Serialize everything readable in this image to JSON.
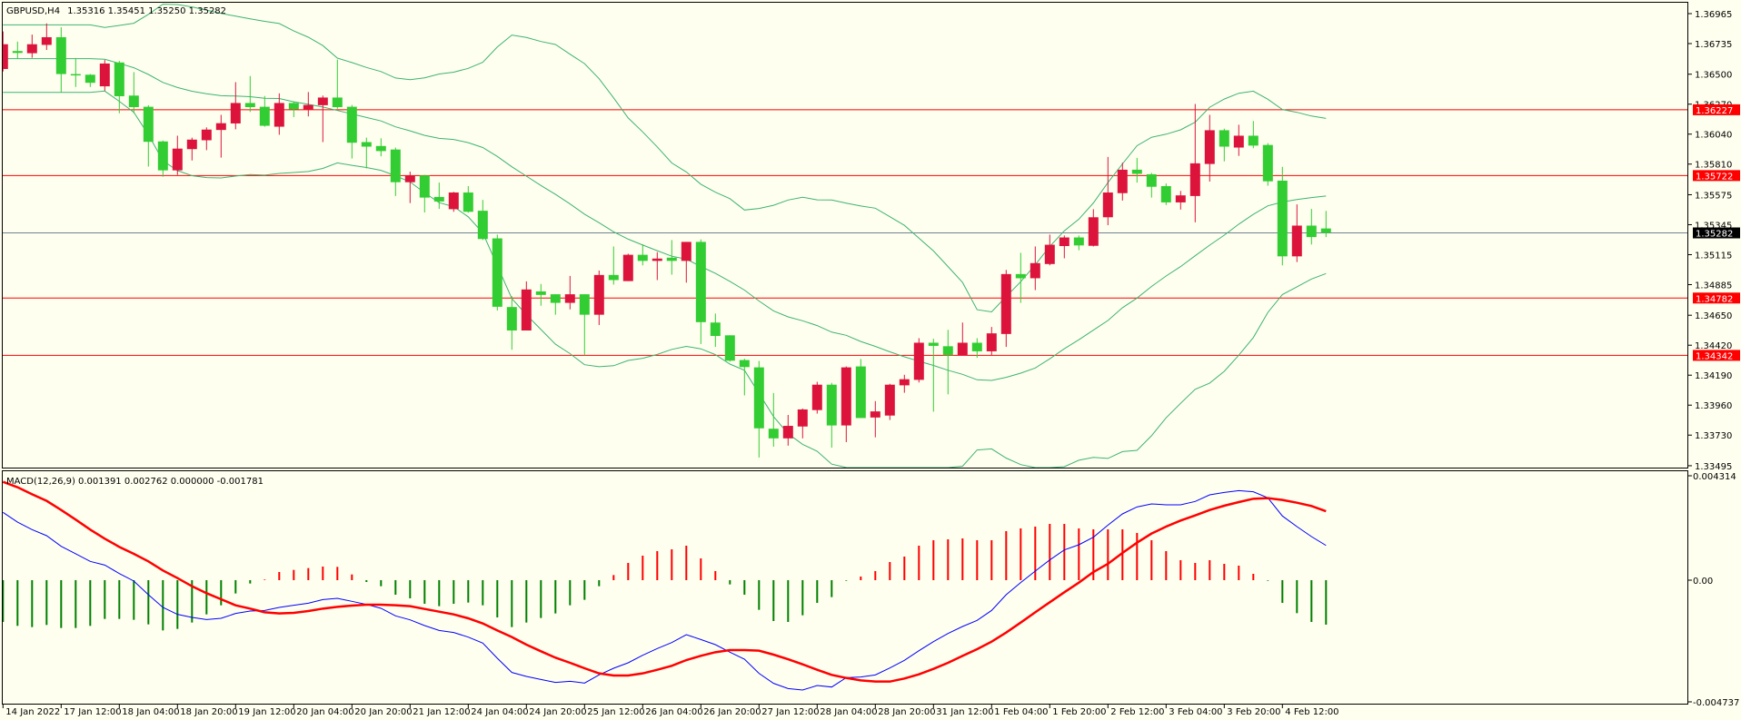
{
  "header": {
    "symbol": "GBPUSD,H4",
    "ohlc_text": "1.35316 1.35451 1.35250 1.35282"
  },
  "macd_header": {
    "label": "MACD(12,26,9)",
    "values_text": "0.001391 0.002762 0.000000 -0.001781"
  },
  "colors": {
    "background": "#fffff0",
    "bull": "#dc143c",
    "bear": "#32cd32",
    "bands": "#3cb371",
    "level_line": "#ff0000",
    "price_line": "#708090",
    "macd_main": "#0000ff",
    "macd_signal": "#ff0000",
    "hist_pos": "#ff0000",
    "hist_neg": "#008000"
  },
  "chart_data": [
    {
      "type": "candlestick",
      "title": "GBPUSD,H4",
      "indicator": "Bollinger Bands (20, 2)",
      "ylim": [
        1.33495,
        1.36965
      ],
      "y_ticks": [
        "1.36965",
        "1.36735",
        "1.36500",
        "1.36270",
        "1.36040",
        "1.35810",
        "1.35575",
        "1.35345",
        "1.35115",
        "1.34885",
        "1.34650",
        "1.34420",
        "1.34190",
        "1.33960",
        "1.33730",
        "1.33495"
      ],
      "x_ticks": [
        "14 Jan 2022",
        "17 Jan 12:00",
        "18 Jan 04:00",
        "18 Jan 20:00",
        "19 Jan 12:00",
        "20 Jan 04:00",
        "20 Jan 20:00",
        "21 Jan 12:00",
        "24 Jan 04:00",
        "24 Jan 20:00",
        "25 Jan 12:00",
        "26 Jan 04:00",
        "26 Jan 20:00",
        "27 Jan 12:00",
        "28 Jan 04:00",
        "28 Jan 20:00",
        "31 Jan 12:00",
        "1 Feb 04:00",
        "1 Feb 20:00",
        "2 Feb 12:00",
        "3 Feb 04:00",
        "3 Feb 20:00",
        "4 Feb 12:00"
      ],
      "x_tick_every_n_bars": 4,
      "levels": [
        {
          "price": 1.36227,
          "label": "1.36227"
        },
        {
          "price": 1.35722,
          "label": "1.35722"
        },
        {
          "price": 1.34782,
          "label": "1.34782"
        },
        {
          "price": 1.34342,
          "label": "1.34342"
        }
      ],
      "current_price": {
        "price": 1.35282,
        "label": "1.35282"
      },
      "ohlc": [
        [
          1.3654,
          1.36828,
          1.36521,
          1.3673
        ],
        [
          1.36678,
          1.3675,
          1.36619,
          1.36663
        ],
        [
          1.36661,
          1.36804,
          1.36626,
          1.3673
        ],
        [
          1.36725,
          1.3689,
          1.36686,
          1.36784
        ],
        [
          1.36784,
          1.3686,
          1.3636,
          1.36501
        ],
        [
          1.36501,
          1.36624,
          1.36402,
          1.36493
        ],
        [
          1.36496,
          1.36501,
          1.36402,
          1.36434
        ],
        [
          1.36407,
          1.36609,
          1.36373,
          1.36582
        ],
        [
          1.3659,
          1.36602,
          1.362,
          1.36331
        ],
        [
          1.36336,
          1.36516,
          1.362,
          1.36247
        ],
        [
          1.3625,
          1.36262,
          1.35791,
          1.35981
        ],
        [
          1.35984,
          1.35991,
          1.35713,
          1.35762
        ],
        [
          1.35762,
          1.36028,
          1.35727,
          1.35929
        ],
        [
          1.35925,
          1.36013,
          1.35838,
          1.35998
        ],
        [
          1.35993,
          1.36092,
          1.35917,
          1.36075
        ],
        [
          1.36072,
          1.36188,
          1.3586,
          1.36124
        ],
        [
          1.36122,
          1.36439,
          1.36077,
          1.36279
        ],
        [
          1.36279,
          1.36486,
          1.3621,
          1.36247
        ],
        [
          1.3625,
          1.36333,
          1.36097,
          1.36104
        ],
        [
          1.36097,
          1.36353,
          1.36035,
          1.36279
        ],
        [
          1.36279,
          1.36292,
          1.36171,
          1.3623
        ],
        [
          1.3623,
          1.36363,
          1.36176,
          1.36264
        ],
        [
          1.36262,
          1.36336,
          1.35979,
          1.36321
        ],
        [
          1.36321,
          1.36612,
          1.36235,
          1.36247
        ],
        [
          1.3625,
          1.36264,
          1.35853,
          1.35974
        ],
        [
          1.35979,
          1.36013,
          1.35777,
          1.35944
        ],
        [
          1.35949,
          1.36008,
          1.3587,
          1.3591
        ],
        [
          1.35922,
          1.35937,
          1.35565,
          1.35671
        ],
        [
          1.35671,
          1.35752,
          1.35511,
          1.35723
        ],
        [
          1.35723,
          1.35727,
          1.35439,
          1.35553
        ],
        [
          1.35558,
          1.35668,
          1.35466,
          1.35523
        ],
        [
          1.35464,
          1.35597,
          1.35444,
          1.35592
        ],
        [
          1.35592,
          1.35641,
          1.35437,
          1.35444
        ],
        [
          1.35452,
          1.35535,
          1.35227,
          1.35235
        ],
        [
          1.3524,
          1.35269,
          1.34686,
          1.34715
        ],
        [
          1.34713,
          1.34796,
          1.34385,
          1.34533
        ],
        [
          1.34533,
          1.3491,
          1.34533,
          1.34848
        ],
        [
          1.34833,
          1.3489,
          1.34723,
          1.34806
        ],
        [
          1.34811,
          1.34811,
          1.34654,
          1.34745
        ],
        [
          1.34745,
          1.34952,
          1.34695,
          1.34811
        ],
        [
          1.34811,
          1.34811,
          1.34343,
          1.34654
        ],
        [
          1.34654,
          1.34993,
          1.34575,
          1.34959
        ],
        [
          1.34959,
          1.35178,
          1.34885,
          1.3492
        ],
        [
          1.34912,
          1.35122,
          1.34912,
          1.35114
        ],
        [
          1.35114,
          1.35195,
          1.35033,
          1.35067
        ],
        [
          1.35067,
          1.35134,
          1.3492,
          1.35085
        ],
        [
          1.35092,
          1.35227,
          1.34961,
          1.35067
        ],
        [
          1.35067,
          1.35213,
          1.349,
          1.35213
        ],
        [
          1.35213,
          1.35232,
          1.34429,
          1.34597
        ],
        [
          1.34594,
          1.34663,
          1.34407,
          1.34491
        ],
        [
          1.34496,
          1.34496,
          1.34294,
          1.34301
        ],
        [
          1.34306,
          1.34316,
          1.34035,
          1.34252
        ],
        [
          1.3425,
          1.34299,
          1.33558,
          1.33782
        ],
        [
          1.33779,
          1.34053,
          1.33641,
          1.33705
        ],
        [
          1.33705,
          1.33885,
          1.33649,
          1.33801
        ],
        [
          1.33796,
          1.33934,
          1.33705,
          1.33927
        ],
        [
          1.33922,
          1.34139,
          1.33895,
          1.34117
        ],
        [
          1.34117,
          1.34131,
          1.33634,
          1.33804
        ],
        [
          1.33804,
          1.34257,
          1.33676,
          1.3425
        ],
        [
          1.34257,
          1.34314,
          1.33861,
          1.33861
        ],
        [
          1.33865,
          1.33991,
          1.33713,
          1.33912
        ],
        [
          1.3388,
          1.34124,
          1.33846,
          1.34117
        ],
        [
          1.34112,
          1.34193,
          1.34055,
          1.34159
        ],
        [
          1.34154,
          1.34474,
          1.34134,
          1.34439
        ],
        [
          1.34439,
          1.34469,
          1.3391,
          1.34415
        ],
        [
          1.34412,
          1.34538,
          1.34043,
          1.34343
        ],
        [
          1.34341,
          1.34594,
          1.34341,
          1.34439
        ],
        [
          1.34439,
          1.34474,
          1.34324,
          1.34373
        ],
        [
          1.34373,
          1.3456,
          1.34341,
          1.34511
        ],
        [
          1.34506,
          1.34998,
          1.34407,
          1.34966
        ],
        [
          1.34966,
          1.35129,
          1.34745,
          1.34934
        ],
        [
          1.34934,
          1.35178,
          1.34843,
          1.3505
        ],
        [
          1.35043,
          1.35269,
          1.35033,
          1.35191
        ],
        [
          1.35181,
          1.35262,
          1.35087,
          1.35247
        ],
        [
          1.35247,
          1.35262,
          1.35149,
          1.35186
        ],
        [
          1.35183,
          1.35464,
          1.35178,
          1.35402
        ],
        [
          1.35402,
          1.35865,
          1.35341,
          1.35592
        ],
        [
          1.35587,
          1.35821,
          1.3553,
          1.35767
        ],
        [
          1.35767,
          1.35858,
          1.35668,
          1.35735
        ],
        [
          1.35732,
          1.35742,
          1.35553,
          1.35636
        ],
        [
          1.35641,
          1.35661,
          1.35496,
          1.35516
        ],
        [
          1.35516,
          1.35604,
          1.35461,
          1.3557
        ],
        [
          1.35565,
          1.36272,
          1.35363,
          1.35816
        ],
        [
          1.35811,
          1.36188,
          1.35676,
          1.3607
        ],
        [
          1.3607,
          1.36082,
          1.35831,
          1.35944
        ],
        [
          1.35937,
          1.36112,
          1.35873,
          1.36028
        ],
        [
          1.36028,
          1.36141,
          1.35932,
          1.35952
        ],
        [
          1.35957,
          1.35971,
          1.35644,
          1.35678
        ],
        [
          1.35683,
          1.35789,
          1.35033,
          1.35102
        ],
        [
          1.35102,
          1.35501,
          1.35058,
          1.35338
        ],
        [
          1.35338,
          1.35466,
          1.35193,
          1.3525
        ],
        [
          1.35316,
          1.35451,
          1.3525,
          1.35282
        ]
      ]
    },
    {
      "type": "line+bar",
      "title": "MACD(12,26,9)",
      "ylim": [
        -0.004737,
        0.004314
      ],
      "y_ticks": [
        "0.004314",
        "0.00",
        "-0.004737"
      ],
      "main": [
        0.002715,
        0.002327,
        0.002024,
        0.001782,
        0.001358,
        0.001055,
        0.000752,
        0.000606,
        0.000267,
        -3.6e-05,
        -0.000582,
        -0.001091,
        -0.00137,
        -0.001491,
        -0.001576,
        -0.001527,
        -0.001333,
        -0.001236,
        -0.001212,
        -0.001091,
        -0.001006,
        -0.000921,
        -0.000776,
        -0.000727,
        -0.000848,
        -0.00097,
        -0.001127,
        -0.00143,
        -0.001588,
        -0.001818,
        -0.002012,
        -0.002097,
        -0.002279,
        -0.002521,
        -0.003127,
        -0.003697,
        -0.003855,
        -0.003976,
        -0.004097,
        -0.004048,
        -0.004121,
        -0.003794,
        -0.003527,
        -0.003309,
        -0.003006,
        -0.002739,
        -0.002497,
        -0.002182,
        -0.002376,
        -0.002582,
        -0.002885,
        -0.003164,
        -0.003733,
        -0.004133,
        -0.004339,
        -0.0044,
        -0.004218,
        -0.004279,
        -0.003903,
        -0.003879,
        -0.003794,
        -0.003515,
        -0.003212,
        -0.002824,
        -0.002461,
        -0.002133,
        -0.001855,
        -0.001612,
        -0.001212,
        -0.000582,
        -9.7e-05,
        0.000364,
        0.000812,
        0.001212,
        0.001418,
        0.001721,
        0.002206,
        0.002655,
        0.002933,
        0.003055,
        0.003018,
        0.003018,
        0.003152,
        0.003418,
        0.003515,
        0.003588,
        0.003539,
        0.003297,
        0.00257,
        0.002145,
        0.001745,
        0.001391
      ],
      "signal": [
        0.003939,
        0.003721,
        0.003442,
        0.003176,
        0.002812,
        0.002424,
        0.002024,
        0.001661,
        0.001333,
        0.001055,
        0.000752,
        0.000388,
        8.5e-05,
        -0.000242,
        -0.000521,
        -0.000764,
        -0.001006,
        -0.001139,
        -0.001285,
        -0.001333,
        -0.001309,
        -0.001236,
        -0.001139,
        -0.001067,
        -0.001018,
        -0.000982,
        -0.000982,
        -0.001006,
        -0.001042,
        -0.001152,
        -0.001261,
        -0.00137,
        -0.001527,
        -0.001733,
        -0.002012,
        -0.002279,
        -0.002582,
        -0.002848,
        -0.003103,
        -0.003309,
        -0.003527,
        -0.003733,
        -0.003818,
        -0.003818,
        -0.003733,
        -0.003588,
        -0.00343,
        -0.0032,
        -0.00303,
        -0.002885,
        -0.0028,
        -0.0028,
        -0.002824,
        -0.002982,
        -0.003164,
        -0.00337,
        -0.003588,
        -0.003794,
        -0.003915,
        -0.004012,
        -0.004061,
        -0.004061,
        -0.003939,
        -0.00377,
        -0.003552,
        -0.003309,
        -0.00303,
        -0.002764,
        -0.002461,
        -0.002097,
        -0.001697,
        -0.001285,
        -0.000885,
        -0.000485,
        -9.7e-05,
        0.000327,
        0.000655,
        0.001091,
        0.001503,
        0.001867,
        0.002145,
        0.002388,
        0.002594,
        0.002812,
        0.002982,
        0.003127,
        0.003261,
        0.003285,
        0.003212,
        0.003103,
        0.00297,
        0.002762
      ],
      "histogram": [
        -0.001673,
        -0.00183,
        -0.001879,
        -0.001794,
        -0.001915,
        -0.001915,
        -0.00183,
        -0.001552,
        -0.001552,
        -0.001588,
        -0.00177,
        -0.002012,
        -0.001952,
        -0.001697,
        -0.00137,
        -0.001006,
        -0.000533,
        -0.000133,
        2.4e-05,
        0.000327,
        0.000412,
        0.000485,
        0.000545,
        0.000533,
        0.00023,
        -7.3e-05,
        -0.000242,
        -0.000582,
        -0.000727,
        -0.000945,
        -0.001042,
        -0.000945,
        -0.000897,
        -0.001006,
        -0.001491,
        -0.001879,
        -0.001697,
        -0.001515,
        -0.001333,
        -0.001006,
        -0.000788,
        -0.000242,
        0.000206,
        0.000691,
        0.000982,
        0.001164,
        0.001236,
        0.001382,
        0.000873,
        0.000364,
        -0.00017,
        -0.000582,
        -0.001188,
        -0.001636,
        -0.001673,
        -0.001406,
        -0.000909,
        -0.000679,
        -2.4e-05,
        0.000145,
        0.000364,
        0.000727,
        0.000945,
        0.001382,
        0.0016,
        0.001636,
        0.001673,
        0.0016,
        0.0016,
        0.001964,
        0.002073,
        0.002145,
        0.002255,
        0.002255,
        0.002073,
        0.002036,
        0.002036,
        0.002036,
        0.001891,
        0.0016,
        0.001164,
        0.0008,
        0.000691,
        0.0008,
        0.000655,
        0.000582,
        0.000255,
        -2.4e-05,
        -0.000909,
        -0.001321,
        -0.001673,
        -0.001781
      ]
    }
  ]
}
